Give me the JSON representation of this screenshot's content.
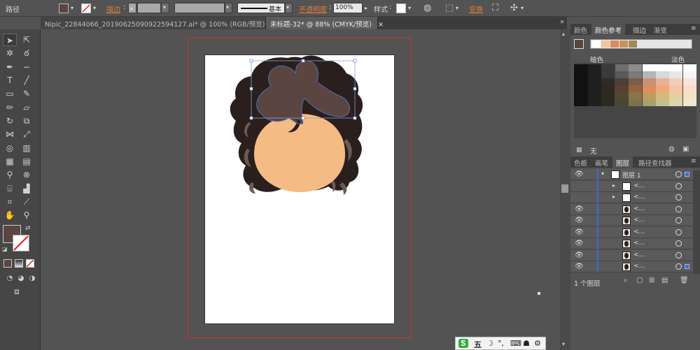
{
  "control_bar": {
    "path_label": "路径",
    "stroke_label": "描边",
    "brush_label": "基本",
    "opacity_label": "不透明度",
    "opacity_value": "100%",
    "style_label": "样式",
    "transform_label": "变换",
    "fill_color": "#5a4540"
  },
  "tabs": [
    {
      "label": "Nipic_22844066_20190625090922594127.ai* @ 100% (RGB/预览)",
      "close": "×"
    },
    {
      "label": "未标题-32* @ 88% (CMYK/预览)",
      "close": "×"
    }
  ],
  "color_panel": {
    "tabs": [
      "颜色",
      "颜色参考",
      "描边",
      "渐变"
    ],
    "active_tab": "颜色参考",
    "dark_label": "暗色",
    "light_label": "淡色",
    "none_label": "无",
    "harmony_colors": [
      "#ffffff",
      "#f3c49c",
      "#e08a5e",
      "#c8925a",
      "#9e8c55"
    ],
    "grid_rows": [
      [
        "#1f1f1f",
        "#3a3a3a",
        "#6e6e6e",
        "#8c8c8c",
        "#ffffff",
        "#ffffff",
        "#ffffff",
        "#ffffff"
      ],
      [
        "#1f1f1f",
        "#3a3a3a",
        "#5a5a5a",
        "#7a7a7a",
        "#b5b5b5",
        "#d8d8d8",
        "#e8e8e8",
        "#f5f5f5"
      ],
      [
        "#1f1f1f",
        "#2e2a27",
        "#4d3f37",
        "#7a5e4e",
        "#c79276",
        "#e6b196",
        "#f2cdb7",
        "#f9e3d6"
      ],
      [
        "#1f1f1f",
        "#2f2722",
        "#5a4032",
        "#94643f",
        "#e28c5c",
        "#f2a77b",
        "#f7c4a3",
        "#fbdcc6"
      ],
      [
        "#1f1f1f",
        "#2e2a20",
        "#514831",
        "#8a7547",
        "#bf9c5c",
        "#d7b77a",
        "#e6cf9f",
        "#f2e3c4"
      ],
      [
        "#1f1f1f",
        "#2b2a20",
        "#4a4632",
        "#7b7350",
        "#a8a06f",
        "#c5be8f",
        "#dcd6af",
        "#ece8cf"
      ]
    ]
  },
  "layers_panel": {
    "tabs": [
      "色板",
      "画笔",
      "图层",
      "路径查找器"
    ],
    "active_tab": "图层",
    "layer_name": "图层 1",
    "sublayer_label": "<...",
    "count_label": "1 个图层"
  },
  "ime_bar": {
    "brand": "S",
    "mode": "五",
    "moon": "☽",
    "punct": "°,",
    "keyboard": "⌨",
    "skin": "☗",
    "wrench": "⚙"
  },
  "colors": {
    "hair": "#2a1f1d",
    "hair_highlight": "#5a4540",
    "face": "#f5bb85",
    "curl": "#6c5a55"
  }
}
